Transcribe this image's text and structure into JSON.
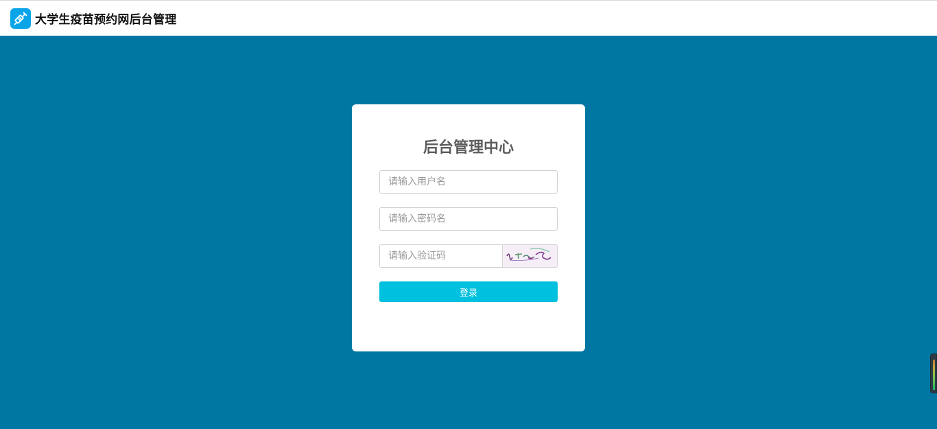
{
  "header": {
    "logo_icon": "syringe-icon",
    "title": "大学生疫苗预约网后台管理"
  },
  "login": {
    "title": "后台管理中心",
    "username_placeholder": "请输入用户名",
    "password_placeholder": "请输入密码名",
    "captcha_placeholder": "请输入验证码",
    "captcha_image_icon": "captcha-image",
    "submit_label": "登录"
  },
  "colors": {
    "background": "#0076a3",
    "button": "#00c0df",
    "logo": "#0aa5e9"
  },
  "side_widget": {
    "icon": "level-meter-icon"
  }
}
